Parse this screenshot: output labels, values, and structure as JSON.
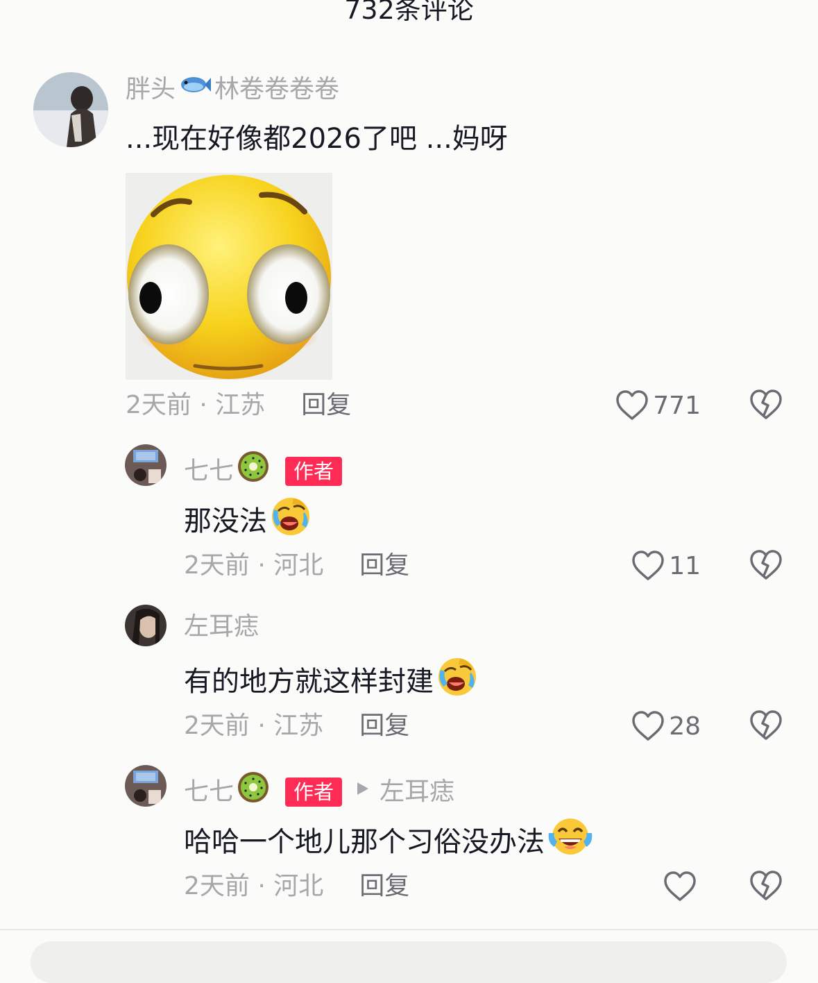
{
  "header": {
    "title": "732条评论"
  },
  "comments": [
    {
      "nickname": "胖头",
      "nickname_suffix": "林卷卷卷卷",
      "nickname_emoji": "fish-icon",
      "text": "...现在好像都2026了吧 ...妈呀",
      "has_sticker": true,
      "sticker": "shocked-face-sticker",
      "time": "2天前",
      "location": "江苏",
      "reply_label": "回复",
      "likes": "771"
    },
    {
      "nickname": "七七",
      "nickname_emoji": "kiwi-icon",
      "badge": "作者",
      "text": "那没法",
      "text_emoji": "laughing-crying-face",
      "time": "2天前",
      "location": "河北",
      "reply_label": "回复",
      "likes": "11"
    },
    {
      "nickname": "左耳痣",
      "text": "有的地方就这样封建",
      "text_emoji": "laughing-crying-face",
      "time": "2天前",
      "location": "江苏",
      "reply_label": "回复",
      "likes": "28"
    },
    {
      "nickname": "七七",
      "nickname_emoji": "kiwi-icon",
      "badge": "作者",
      "reply_to": "左耳痣",
      "text": "哈哈一个地儿那个习俗没办法",
      "text_emoji": "tears-of-joy-face",
      "time": "2天前",
      "location": "河北",
      "reply_label": "回复",
      "likes": ""
    }
  ],
  "colors": {
    "badge": "#fe2c55",
    "muted": "#a6a7ab",
    "text": "#161823"
  }
}
